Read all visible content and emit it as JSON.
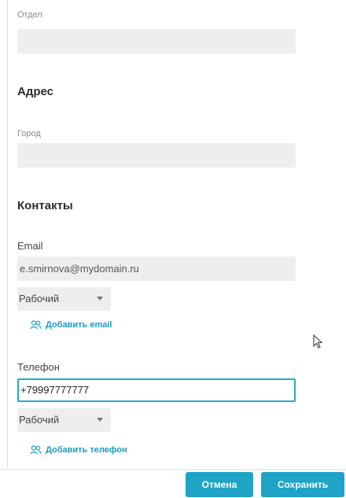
{
  "department": {
    "label": "Отдел",
    "value": ""
  },
  "address": {
    "heading": "Адрес",
    "city_label": "Город",
    "city_value": ""
  },
  "contacts": {
    "heading": "Контакты",
    "email_label": "Email",
    "email_value": "e.smirnova@mydomain.ru",
    "email_type": "Рабочий",
    "add_email": "Добавить email",
    "phone_label": "Телефон",
    "phone_value": "+79997777777",
    "phone_type": "Рабочий",
    "add_phone": "Добавить телефон"
  },
  "footer": {
    "cancel_label": "Отмена",
    "save_label": "Сохранить"
  },
  "colors": {
    "accent": "#1fa3c6",
    "field_bg": "#eeeeef"
  },
  "icons": {
    "add": "add-contact-icon",
    "caret": "chevron-down-icon",
    "cursor": "mouse-pointer-icon"
  }
}
